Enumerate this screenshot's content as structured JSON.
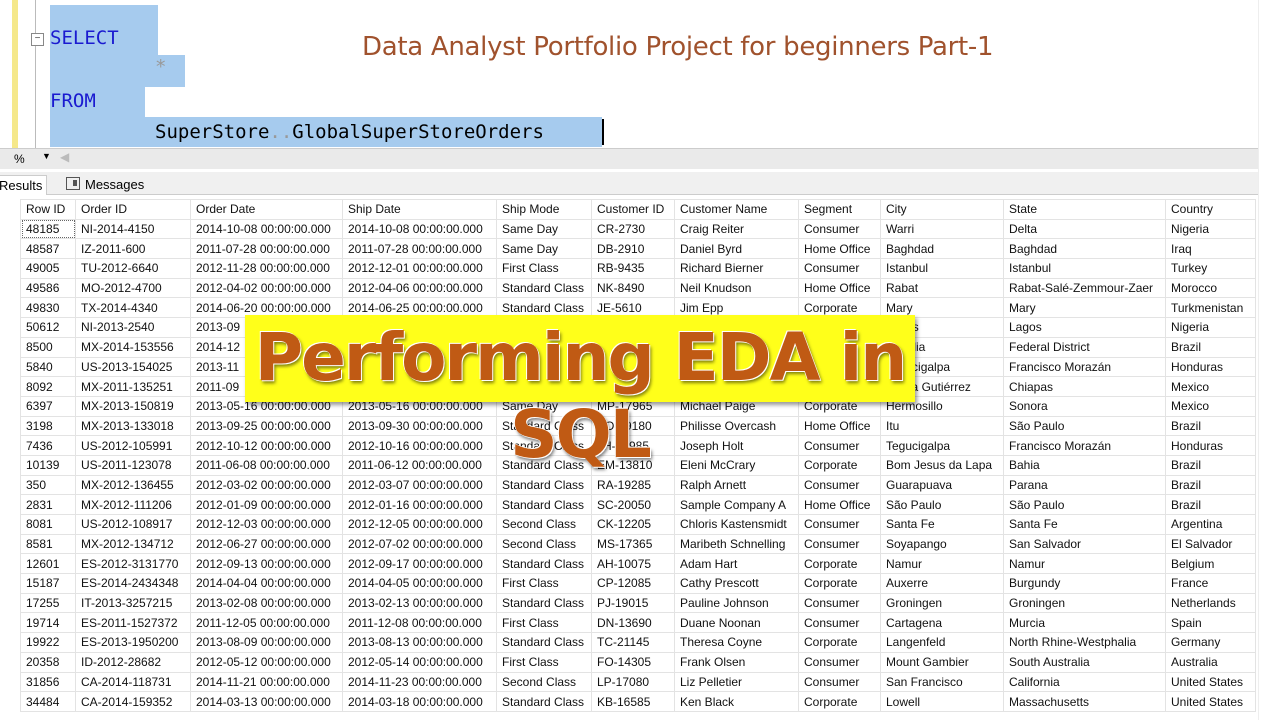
{
  "editor": {
    "line1": "SELECT",
    "line2": "*",
    "line3": "FROM",
    "line4a": "SuperStore",
    "line4b": "..",
    "line4c": "GlobalSuperStoreOrders",
    "keyword_color": "#1a1ad0",
    "selection_color": "#a6cbee"
  },
  "overlay_title": "Data Analyst Portfolio Project for beginners Part-1",
  "banner": "Performing EDA in SQL",
  "zoom": {
    "value": "%"
  },
  "tabs": [
    {
      "label": "Results"
    },
    {
      "label": "Messages"
    }
  ],
  "table": {
    "columns": [
      "Row ID",
      "Order ID",
      "Order Date",
      "Ship Date",
      "Ship Mode",
      "Customer ID",
      "Customer Name",
      "Segment",
      "City",
      "State",
      "Country"
    ],
    "rows": [
      [
        "48185",
        "NI-2014-4150",
        "2014-10-08 00:00:00.000",
        "2014-10-08 00:00:00.000",
        "Same Day",
        "CR-2730",
        "Craig Reiter",
        "Consumer",
        "Warri",
        "Delta",
        "Nigeria"
      ],
      [
        "48587",
        "IZ-2011-600",
        "2011-07-28 00:00:00.000",
        "2011-07-28 00:00:00.000",
        "Same Day",
        "DB-2910",
        "Daniel Byrd",
        "Home Office",
        "Baghdad",
        "Baghdad",
        "Iraq"
      ],
      [
        "49005",
        "TU-2012-6640",
        "2012-11-28 00:00:00.000",
        "2012-12-01 00:00:00.000",
        "First Class",
        "RB-9435",
        "Richard Bierner",
        "Consumer",
        "Istanbul",
        "Istanbul",
        "Turkey"
      ],
      [
        "49586",
        "MO-2012-4700",
        "2012-04-02 00:00:00.000",
        "2012-04-06 00:00:00.000",
        "Standard Class",
        "NK-8490",
        "Neil Knudson",
        "Home Office",
        "Rabat",
        "Rabat-Salé-Zemmour-Zaer",
        "Morocco"
      ],
      [
        "49830",
        "TX-2014-4340",
        "2014-06-20 00:00:00.000",
        "2014-06-25 00:00:00.000",
        "Standard Class",
        "JE-5610",
        "Jim Epp",
        "Corporate",
        "Mary",
        "Mary",
        "Turkmenistan"
      ],
      [
        "50612",
        "NI-2013-2540",
        "2013-09",
        "",
        "",
        "",
        "",
        "",
        "Lagos",
        "Lagos",
        "Nigeria"
      ],
      [
        "8500",
        "MX-2014-153556",
        "2014-12",
        "",
        "",
        "",
        "",
        "",
        "Brasilia",
        "Federal District",
        "Brazil"
      ],
      [
        "5840",
        "US-2013-154025",
        "2013-11",
        "",
        "",
        "",
        "",
        "",
        "Tegucigalpa",
        "Francisco Morazán",
        "Honduras"
      ],
      [
        "8092",
        "MX-2011-135251",
        "2011-09",
        "",
        "",
        "",
        "",
        "",
        "Tuxtla Gutiérrez",
        "Chiapas",
        "Mexico"
      ],
      [
        "6397",
        "MX-2013-150819",
        "2013-05-16 00:00:00.000",
        "2013-05-16 00:00:00.000",
        "Same Day",
        "MP-17965",
        "Michael Paige",
        "Corporate",
        "Hermosillo",
        "Sonora",
        "Mexico"
      ],
      [
        "3198",
        "MX-2013-133018",
        "2013-09-25 00:00:00.000",
        "2013-09-30 00:00:00.000",
        "Standard Class",
        "PO-19180",
        "Philisse Overcash",
        "Home Office",
        "Itu",
        "São Paulo",
        "Brazil"
      ],
      [
        "7436",
        "US-2012-105991",
        "2012-10-12 00:00:00.000",
        "2012-10-16 00:00:00.000",
        "Standard Class",
        "JH-15985",
        "Joseph Holt",
        "Consumer",
        "Tegucigalpa",
        "Francisco Morazán",
        "Honduras"
      ],
      [
        "10139",
        "US-2011-123078",
        "2011-06-08 00:00:00.000",
        "2011-06-12 00:00:00.000",
        "Standard Class",
        "EM-13810",
        "Eleni McCrary",
        "Corporate",
        "Bom Jesus da Lapa",
        "Bahia",
        "Brazil"
      ],
      [
        "350",
        "MX-2012-136455",
        "2012-03-02 00:00:00.000",
        "2012-03-07 00:00:00.000",
        "Standard Class",
        "RA-19285",
        "Ralph Arnett",
        "Consumer",
        "Guarapuava",
        "Parana",
        "Brazil"
      ],
      [
        "2831",
        "MX-2012-111206",
        "2012-01-09 00:00:00.000",
        "2012-01-16 00:00:00.000",
        "Standard Class",
        "SC-20050",
        "Sample Company A",
        "Home Office",
        "São Paulo",
        "São Paulo",
        "Brazil"
      ],
      [
        "8081",
        "US-2012-108917",
        "2012-12-03 00:00:00.000",
        "2012-12-05 00:00:00.000",
        "Second Class",
        "CK-12205",
        "Chloris Kastensmidt",
        "Consumer",
        "Santa Fe",
        "Santa Fe",
        "Argentina"
      ],
      [
        "8581",
        "MX-2012-134712",
        "2012-06-27 00:00:00.000",
        "2012-07-02 00:00:00.000",
        "Second Class",
        "MS-17365",
        "Maribeth Schnelling",
        "Consumer",
        "Soyapango",
        "San Salvador",
        "El Salvador"
      ],
      [
        "12601",
        "ES-2012-3131770",
        "2012-09-13 00:00:00.000",
        "2012-09-17 00:00:00.000",
        "Standard Class",
        "AH-10075",
        "Adam Hart",
        "Corporate",
        "Namur",
        "Namur",
        "Belgium"
      ],
      [
        "15187",
        "ES-2014-2434348",
        "2014-04-04 00:00:00.000",
        "2014-04-05 00:00:00.000",
        "First Class",
        "CP-12085",
        "Cathy Prescott",
        "Corporate",
        "Auxerre",
        "Burgundy",
        "France"
      ],
      [
        "17255",
        "IT-2013-3257215",
        "2013-02-08 00:00:00.000",
        "2013-02-13 00:00:00.000",
        "Standard Class",
        "PJ-19015",
        "Pauline Johnson",
        "Consumer",
        "Groningen",
        "Groningen",
        "Netherlands"
      ],
      [
        "19714",
        "ES-2011-1527372",
        "2011-12-05 00:00:00.000",
        "2011-12-08 00:00:00.000",
        "First Class",
        "DN-13690",
        "Duane Noonan",
        "Consumer",
        "Cartagena",
        "Murcia",
        "Spain"
      ],
      [
        "19922",
        "ES-2013-1950200",
        "2013-08-09 00:00:00.000",
        "2013-08-13 00:00:00.000",
        "Standard Class",
        "TC-21145",
        "Theresa Coyne",
        "Corporate",
        "Langenfeld",
        "North Rhine-Westphalia",
        "Germany"
      ],
      [
        "20358",
        "ID-2012-28682",
        "2012-05-12 00:00:00.000",
        "2012-05-14 00:00:00.000",
        "First Class",
        "FO-14305",
        "Frank Olsen",
        "Consumer",
        "Mount Gambier",
        "South Australia",
        "Australia"
      ],
      [
        "31856",
        "CA-2014-118731",
        "2014-11-21 00:00:00.000",
        "2014-11-23 00:00:00.000",
        "Second Class",
        "LP-17080",
        "Liz Pelletier",
        "Consumer",
        "San Francisco",
        "California",
        "United States"
      ],
      [
        "34484",
        "CA-2014-159352",
        "2014-03-13 00:00:00.000",
        "2014-03-18 00:00:00.000",
        "Standard Class",
        "KB-16585",
        "Ken Black",
        "Corporate",
        "Lowell",
        "Massachusetts",
        "United States"
      ]
    ]
  }
}
